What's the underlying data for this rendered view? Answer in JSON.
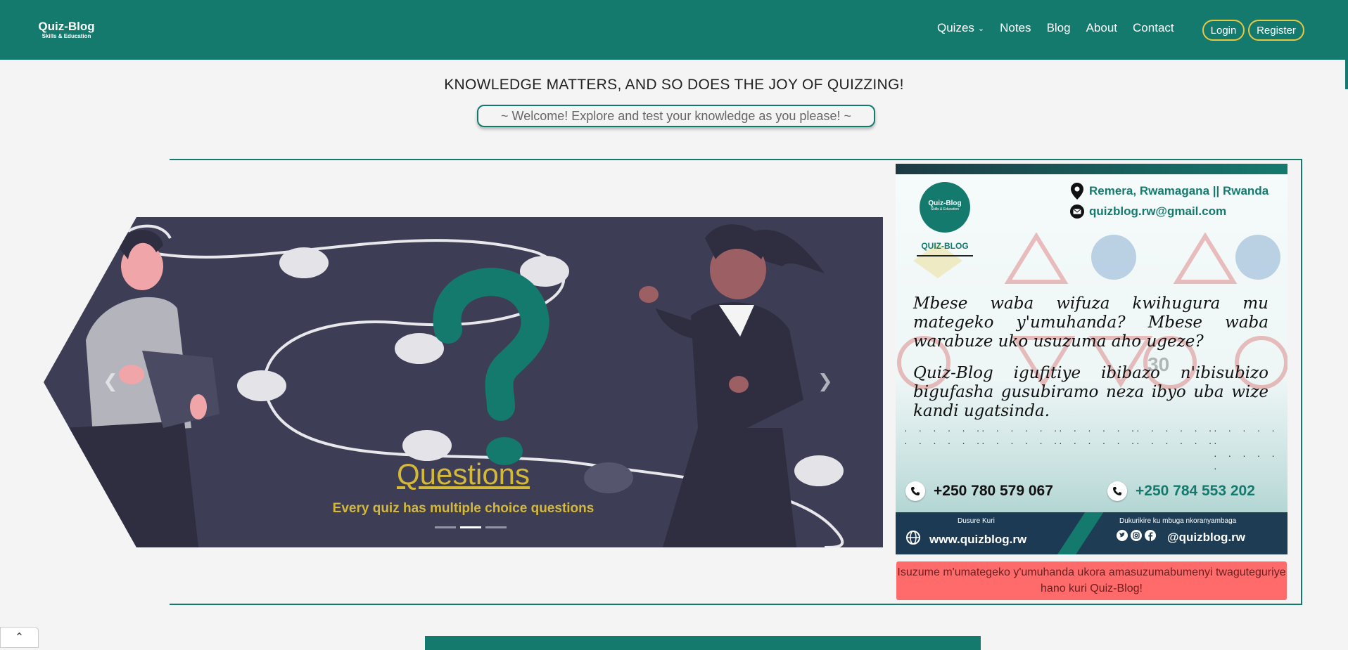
{
  "nav": {
    "brand_title": "Quiz-Blog",
    "brand_sub": "Skills & Education",
    "links": [
      "Quizes",
      "Notes",
      "Blog",
      "About",
      "Contact"
    ],
    "login": "Login",
    "register": "Register"
  },
  "hero": {
    "tagline": "KNOWLEDGE MATTERS, AND SO DOES THE JOY OF QUIZZING!",
    "welcome": "~  Welcome! Explore and test your knowledge as you please!  ~"
  },
  "carousel": {
    "title": "Questions",
    "subtitle": "Every quiz has multiple choice questions",
    "slide_count": 3,
    "active_index": 1
  },
  "ad": {
    "logo_title": "Quiz-Blog",
    "logo_sub": "Skills & Education",
    "logo_text": "QUIZ-BLOG",
    "location": "Remera, Rwamagana || Rwanda",
    "email": "quizblog.rw@gmail.com",
    "para1": "Mbese waba wifuza kwihugura mu mategeko y'umuhanda? Mbese waba warabuze uko usuzuma aho ugeze?",
    "para2": "Quiz-Blog igufitiye ibibazo n'ibisubizo bigufasha gusubiramo neza ibyo uba wize kandi ugatsinda.",
    "phone1": "+250 780 579 067",
    "phone2": "+250 784 553 202",
    "web_label": "Dusure Kuri",
    "web_value": "www.quizblog.rw",
    "social_label": "Dukurikire ku mbuga nkoranyambaga",
    "social_value": "@quizblog.rw",
    "colors": {
      "accent": "#157a6e",
      "navy": "#1d3a55"
    }
  },
  "alert_text": "Isuzume m'umategeko y'umuhanda ukora amasuzumabumenyi twaguteguriye hano kuri Quiz-Blog!",
  "colors": {
    "primary": "#157a6e",
    "gold": "#d4b83a",
    "alert": "#ff6b6b"
  }
}
